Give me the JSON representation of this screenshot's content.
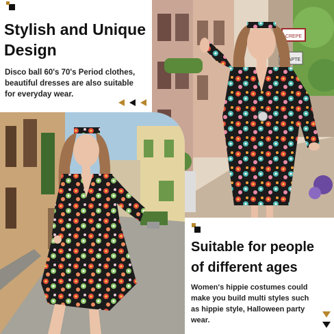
{
  "section_top": {
    "title_line1": "Stylish and Unique",
    "title_line2": "Design",
    "desc_line1": "Disco ball 60's 70's Period clothes,",
    "desc_line2": "beautiful dresses are also suitable",
    "desc_line3": "for everyday wear."
  },
  "section_bottom": {
    "title_line1": "Suitable for people",
    "title_line2": "of different ages",
    "desc_line1": "Women's hippie costumes could",
    "desc_line2": "make you build multi styles such",
    "desc_line3": "as hippie style, Halloween party",
    "desc_line4": "wear."
  },
  "street_signs": {
    "sign_top": "CREPE",
    "sign_bottom": "CHAPTE"
  },
  "colors": {
    "accent_gold": "#b8862b",
    "accent_black": "#111111",
    "dress_base": "#1b1b1b"
  }
}
